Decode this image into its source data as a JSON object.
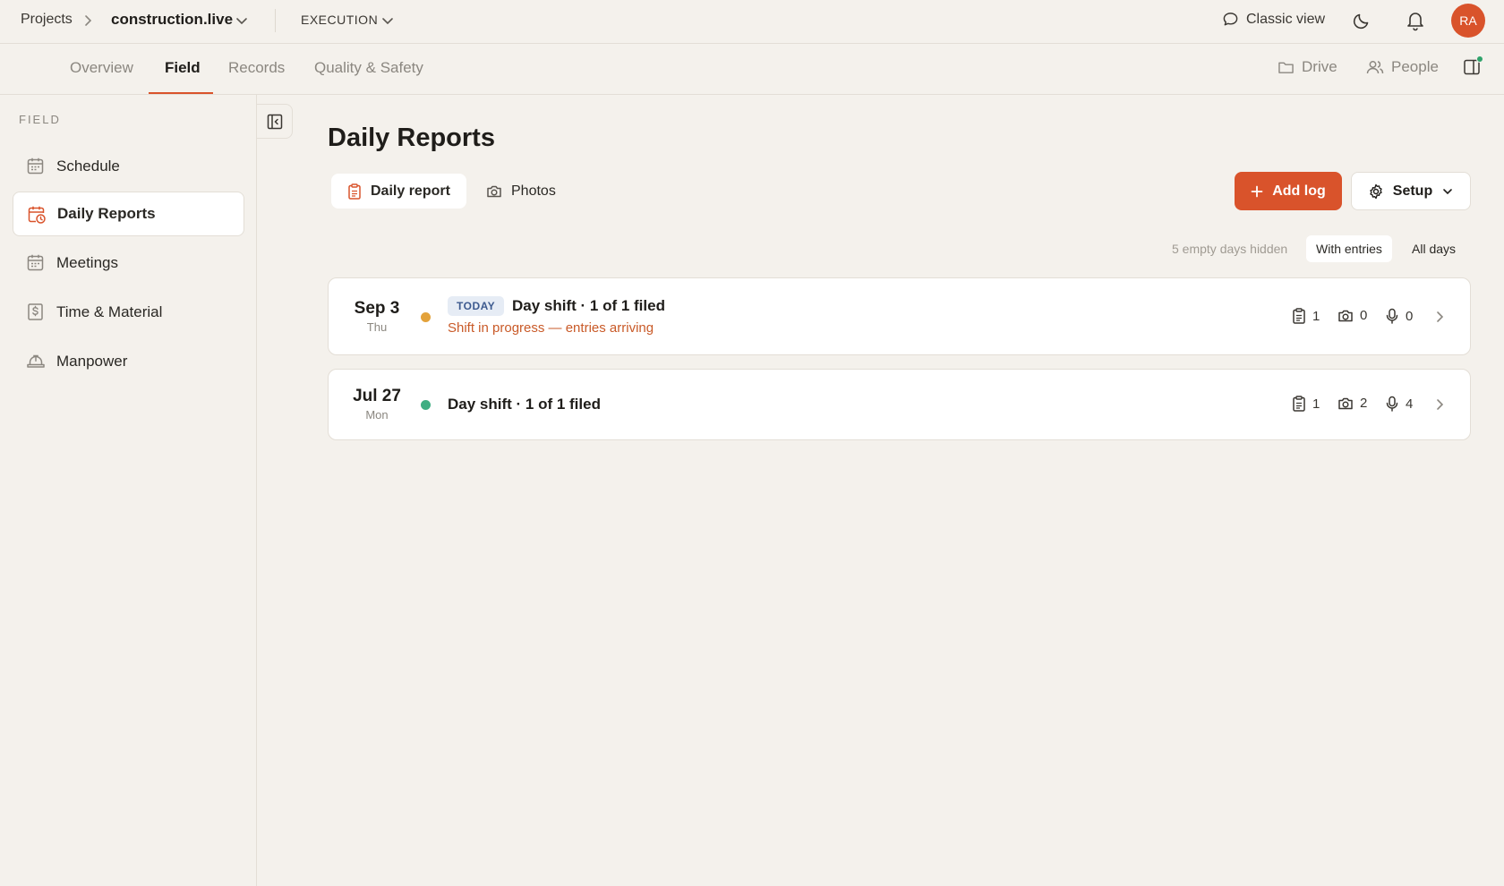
{
  "topbar": {
    "breadcrumb_root": "Projects",
    "project_name": "construction.live",
    "phase": "EXECUTION",
    "classic_view_label": "Classic view",
    "avatar_initials": "RA"
  },
  "nav": {
    "tabs": [
      {
        "label": "Overview"
      },
      {
        "label": "Field",
        "active": true
      },
      {
        "label": "Records"
      },
      {
        "label": "Quality & Safety"
      }
    ],
    "drive_label": "Drive",
    "people_label": "People"
  },
  "sidebar": {
    "heading": "FIELD",
    "items": [
      {
        "label": "Schedule",
        "icon": "calendar-icon"
      },
      {
        "label": "Daily Reports",
        "icon": "calendar-clock-icon",
        "active": true
      },
      {
        "label": "Meetings",
        "icon": "calendar-icon"
      },
      {
        "label": "Time & Material",
        "icon": "dollar-receipt-icon"
      },
      {
        "label": "Manpower",
        "icon": "hard-hat-icon"
      }
    ]
  },
  "main": {
    "title": "Daily Reports",
    "view_tabs": [
      {
        "label": "Daily report",
        "icon": "clipboard-icon",
        "active": true
      },
      {
        "label": "Photos",
        "icon": "camera-icon"
      }
    ],
    "add_log_label": "Add log",
    "setup_label": "Setup",
    "hidden_note": "5 empty days hidden",
    "filter": {
      "options": [
        "With entries",
        "All days"
      ],
      "selected": "With entries"
    },
    "entries": [
      {
        "date": "Sep 3",
        "weekday": "Thu",
        "badge": "TODAY",
        "title": "Day shift · 1 of 1 filed",
        "subtitle": "Shift in progress — entries arriving",
        "status_color": "#e3a23b",
        "reports": "1",
        "photos": "0",
        "voice_notes": "0"
      },
      {
        "date": "Jul 27",
        "weekday": "Mon",
        "title": "Day shift · 1 of 1 filed",
        "status_color": "#3fae82",
        "reports": "1",
        "photos": "2",
        "voice_notes": "4"
      }
    ]
  },
  "colors": {
    "accent": "#d9532b",
    "background": "#f4f1ec",
    "status_online": "#2fa36b"
  }
}
